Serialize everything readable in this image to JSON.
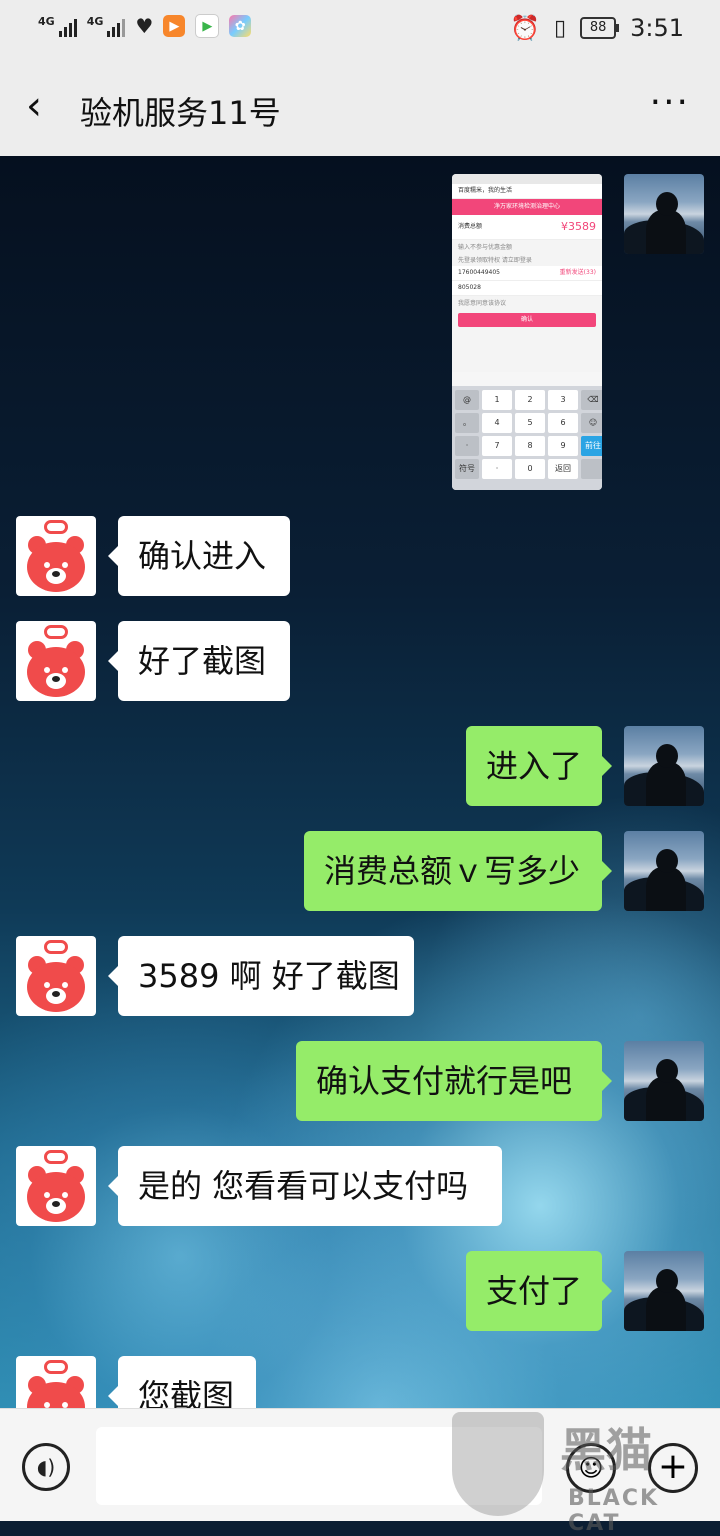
{
  "status_bar": {
    "network1": "4G",
    "network2": "4G",
    "battery": "88",
    "time": "3:51",
    "icons": [
      "signal-icon",
      "signal-icon",
      "health-icon",
      "video-app-icon",
      "play-store-icon",
      "gallery-icon",
      "alarm-icon",
      "vibrate-icon",
      "battery-icon"
    ]
  },
  "header": {
    "back_glyph": "‹",
    "title": "验机服务11号",
    "more_glyph": "···"
  },
  "screenshot_thumb": {
    "top_bar": "百度糯米，我的生活",
    "nav_title": "净万家环境检测治理中心",
    "label_amount": "消费总额",
    "amount": "¥3589",
    "hint1": "输入不参与优惠金额",
    "hint2": "先登录领取特权 请立即登录",
    "phone": "17600449405",
    "resend": "重新发送(33)",
    "code": "805028",
    "agreement": "我愿意同意该协议",
    "confirm": "确认",
    "keys": [
      "@",
      "1",
      "2",
      "3",
      "⌫",
      "。",
      "4",
      "5",
      "6",
      "☺",
      "·",
      "7",
      "8",
      "9",
      "前往",
      "符号",
      "·",
      "0",
      "返回",
      ""
    ]
  },
  "messages": [
    {
      "side": "in",
      "text": "确认进入"
    },
    {
      "side": "in",
      "text": "好了截图"
    },
    {
      "side": "out",
      "text": "进入了"
    },
    {
      "side": "out",
      "text": "消费总额ｖ写多少"
    },
    {
      "side": "in",
      "text": "3589 啊 好了截图"
    },
    {
      "side": "out",
      "text": "确认支付就行是吧"
    },
    {
      "side": "in",
      "text": "是的 您看看可以支付吗"
    },
    {
      "side": "out",
      "text": "支付了"
    },
    {
      "side": "in",
      "text": "您截图"
    }
  ],
  "input_bar": {
    "voice_glyph": "◖)",
    "emoji_glyph": "☺",
    "plus_glyph": "+"
  },
  "watermark": {
    "cn": "黑猫",
    "en": "BLACK CAT"
  }
}
